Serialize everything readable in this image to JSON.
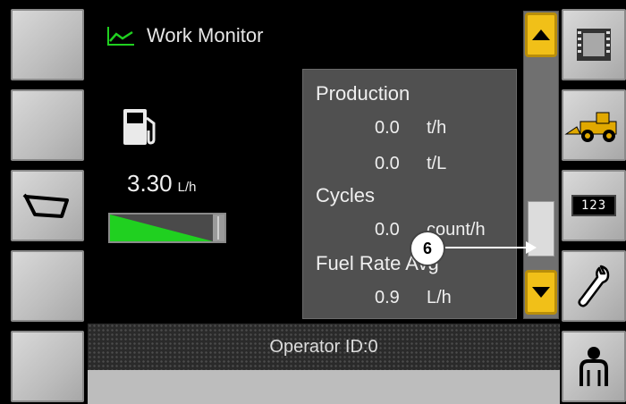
{
  "header": {
    "title": "Work Monitor",
    "icon": "chart-line-icon"
  },
  "fuel": {
    "icon": "fuel-pump-icon",
    "rate_value": "3.30",
    "rate_unit": "L/h",
    "level_fraction": 1.0
  },
  "panel": {
    "production_label": "Production",
    "rows": [
      {
        "value": "0.0",
        "unit": "t/h"
      },
      {
        "value": "0.0",
        "unit": "t/L"
      }
    ],
    "cycles_label": "Cycles",
    "cycles_value": "0.0",
    "cycles_unit": "count/h",
    "fuel_rate_label": "Fuel Rate Avg",
    "fuel_rate_value": "0.9",
    "fuel_rate_unit": "L/h"
  },
  "callout": {
    "number": "6"
  },
  "operator": {
    "text": "Operator ID:0"
  },
  "left_softkeys": [
    "blank",
    "blank",
    "bucket-icon",
    "blank",
    "blank"
  ],
  "right_softkeys": [
    "camera-film-icon",
    "wheel-loader-icon",
    "counter-123-icon",
    "wrench-icon",
    "operator-icon"
  ],
  "counter_text": "123",
  "colors": {
    "accent_green": "#20d020",
    "scroll_yellow": "#f1c018",
    "background": "#000000"
  }
}
